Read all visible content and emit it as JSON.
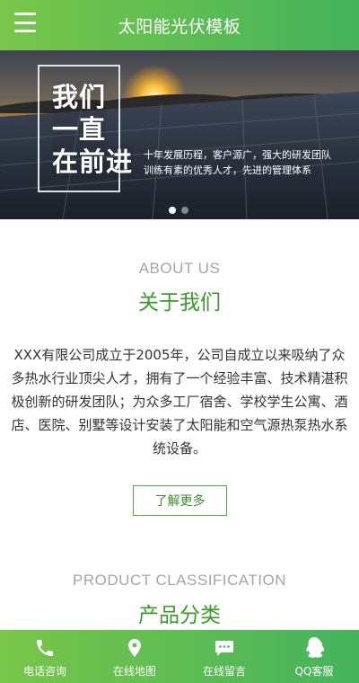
{
  "header": {
    "title": "太阳能光伏模板",
    "menu_icon": "hamburger-menu-icon"
  },
  "banner": {
    "slogan_lines": [
      "我们",
      "一直",
      "在前进"
    ],
    "tagline_lines": [
      "十年发展历程，客户源广，强大的研发团队",
      "训练有素的优秀人才，先进的管理体系"
    ],
    "slide_count": 2,
    "active_slide": 1
  },
  "about": {
    "title_en": "ABOUT US",
    "title_cn": "关于我们",
    "paragraph": "XXX有限公司成立于2005年，公司自成立以来吸纳了众多热水行业顶尖人才，拥有了一个经验丰富、技术精湛积极创新的研发团队；为众多工厂宿舍、学校学生公寓、酒店、医院、别墅等设计安装了太阳能和空气源热泵热水系统设备。",
    "more_label": "了解更多"
  },
  "products": {
    "title_en": "PRODUCT CLASSIFICATION",
    "title_cn": "产品分类"
  },
  "footer": {
    "items": [
      {
        "label": "电话咨询",
        "icon": "phone-icon"
      },
      {
        "label": "在线地图",
        "icon": "map-pin-icon"
      },
      {
        "label": "在线留言",
        "icon": "message-icon"
      },
      {
        "label": "QQ客服",
        "icon": "qq-icon"
      }
    ]
  },
  "colors": {
    "brand_green_start": "#79c64a",
    "brand_green_end": "#45b35c",
    "heading_green": "#3a9a2a",
    "subtitle_gray": "#a5a5a5"
  }
}
